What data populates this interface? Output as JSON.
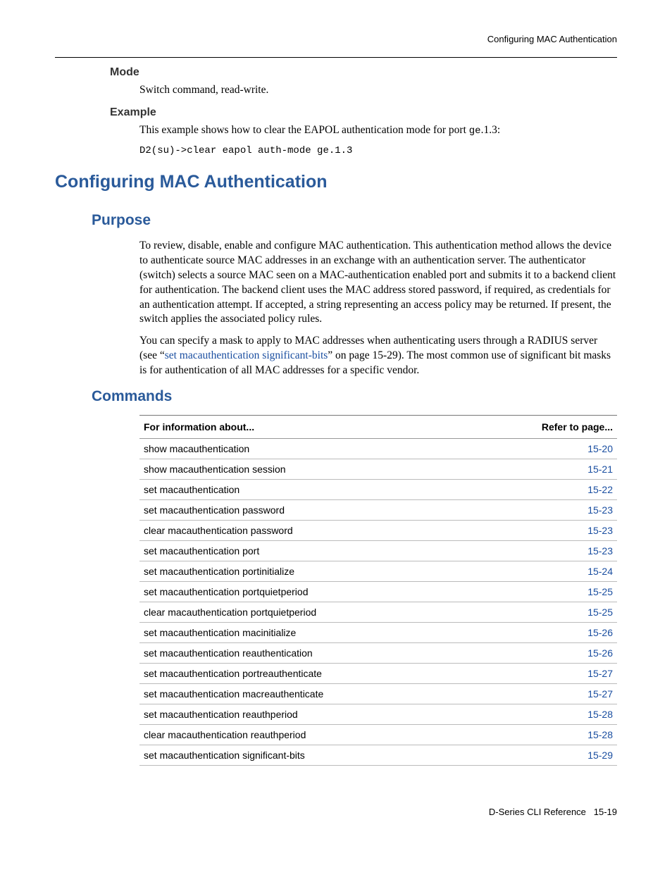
{
  "header": {
    "text": "Configuring MAC Authentication"
  },
  "mode_section": {
    "heading": "Mode",
    "text": "Switch command, read-write."
  },
  "example_section": {
    "heading": "Example",
    "intro_prefix": "This example shows how to clear the EAPOL authentication mode for port ",
    "intro_code": "ge",
    "intro_suffix": ".1.3:",
    "code": "D2(su)->clear eapol auth-mode ge.1.3"
  },
  "h1": "Configuring MAC Authentication",
  "purpose": {
    "heading": "Purpose",
    "p1": "To review, disable, enable and configure MAC authentication. This authentication method allows the device to authenticate source MAC addresses in an exchange with an authentication server. The authenticator (switch) selects a source MAC seen on a MAC-authentication enabled port and submits it to a backend client for authentication. The backend client uses the MAC address stored password, if required, as credentials for an authentication attempt. If accepted, a string representing an access policy may be returned. If present, the switch applies the associated policy rules.",
    "p2_prefix": "You can specify a mask to apply to MAC addresses when authenticating users through a RADIUS server (see “",
    "p2_link": "set macauthentication significant-bits",
    "p2_suffix": "” on page 15-29). The most common use of significant bit masks is for authentication of all MAC addresses for a specific vendor."
  },
  "commands": {
    "heading": "Commands",
    "col1": "For information about...",
    "col2": "Refer to page...",
    "rows": [
      {
        "name": "show macauthentication",
        "page": "15-20"
      },
      {
        "name": "show macauthentication session",
        "page": "15-21"
      },
      {
        "name": "set macauthentication",
        "page": "15-22"
      },
      {
        "name": "set macauthentication password",
        "page": "15-23"
      },
      {
        "name": "clear macauthentication password",
        "page": "15-23"
      },
      {
        "name": "set macauthentication port",
        "page": "15-23"
      },
      {
        "name": "set macauthentication portinitialize",
        "page": "15-24"
      },
      {
        "name": "set macauthentication portquietperiod",
        "page": "15-25"
      },
      {
        "name": "clear macauthentication portquietperiod",
        "page": "15-25"
      },
      {
        "name": "set macauthentication macinitialize",
        "page": "15-26"
      },
      {
        "name": "set macauthentication reauthentication",
        "page": "15-26"
      },
      {
        "name": "set macauthentication portreauthenticate",
        "page": "15-27"
      },
      {
        "name": "set macauthentication macreauthenticate",
        "page": "15-27"
      },
      {
        "name": "set macauthentication reauthperiod",
        "page": "15-28"
      },
      {
        "name": "clear macauthentication reauthperiod",
        "page": "15-28"
      },
      {
        "name": "set macauthentication significant-bits",
        "page": "15-29"
      }
    ]
  },
  "footer": {
    "left": "D-Series CLI Reference",
    "right": "15-19"
  }
}
